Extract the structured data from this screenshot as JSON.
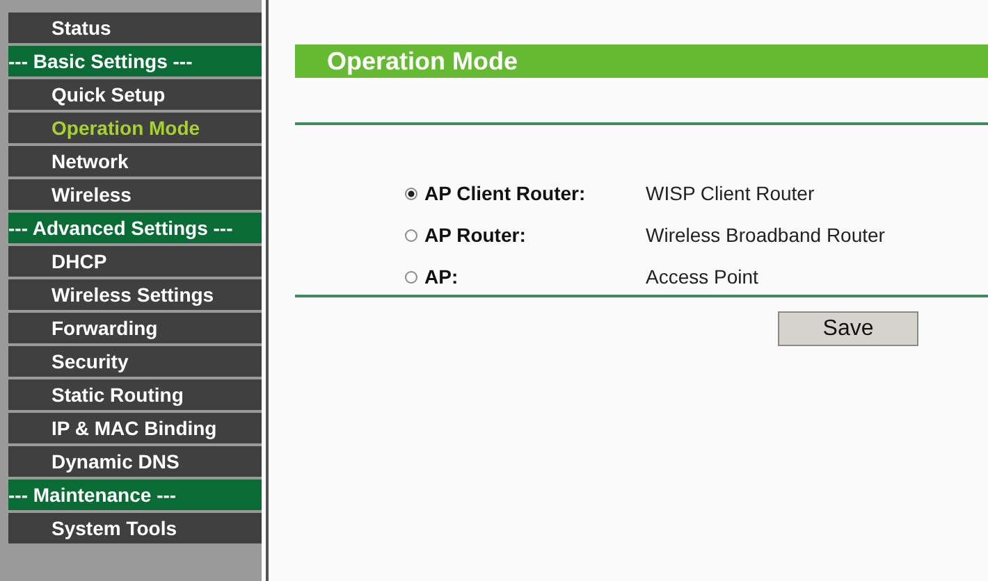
{
  "sidebar": {
    "items": [
      {
        "kind": "item",
        "label": "Status",
        "selected": false
      },
      {
        "kind": "section",
        "label": "--- Basic Settings ---"
      },
      {
        "kind": "item",
        "label": "Quick Setup",
        "selected": false
      },
      {
        "kind": "item",
        "label": "Operation Mode",
        "selected": true
      },
      {
        "kind": "item",
        "label": "Network",
        "selected": false
      },
      {
        "kind": "item",
        "label": "Wireless",
        "selected": false
      },
      {
        "kind": "section",
        "label": "--- Advanced Settings ---"
      },
      {
        "kind": "item",
        "label": "DHCP",
        "selected": false
      },
      {
        "kind": "item",
        "label": "Wireless Settings",
        "selected": false
      },
      {
        "kind": "item",
        "label": "Forwarding",
        "selected": false
      },
      {
        "kind": "item",
        "label": "Security",
        "selected": false
      },
      {
        "kind": "item",
        "label": "Static Routing",
        "selected": false
      },
      {
        "kind": "item",
        "label": "IP & MAC Binding",
        "selected": false
      },
      {
        "kind": "item",
        "label": "Dynamic DNS",
        "selected": false
      },
      {
        "kind": "section",
        "label": "--- Maintenance ---"
      },
      {
        "kind": "item",
        "label": "System Tools",
        "selected": false
      }
    ]
  },
  "panel": {
    "title": "Operation Mode",
    "modes": [
      {
        "label": "AP Client Router:",
        "description": "WISP Client Router",
        "selected": true
      },
      {
        "label": "AP Router:",
        "description": "Wireless Broadband Router",
        "selected": false
      },
      {
        "label": "AP:",
        "description": "Access Point",
        "selected": false
      }
    ],
    "save_button": "Save"
  }
}
